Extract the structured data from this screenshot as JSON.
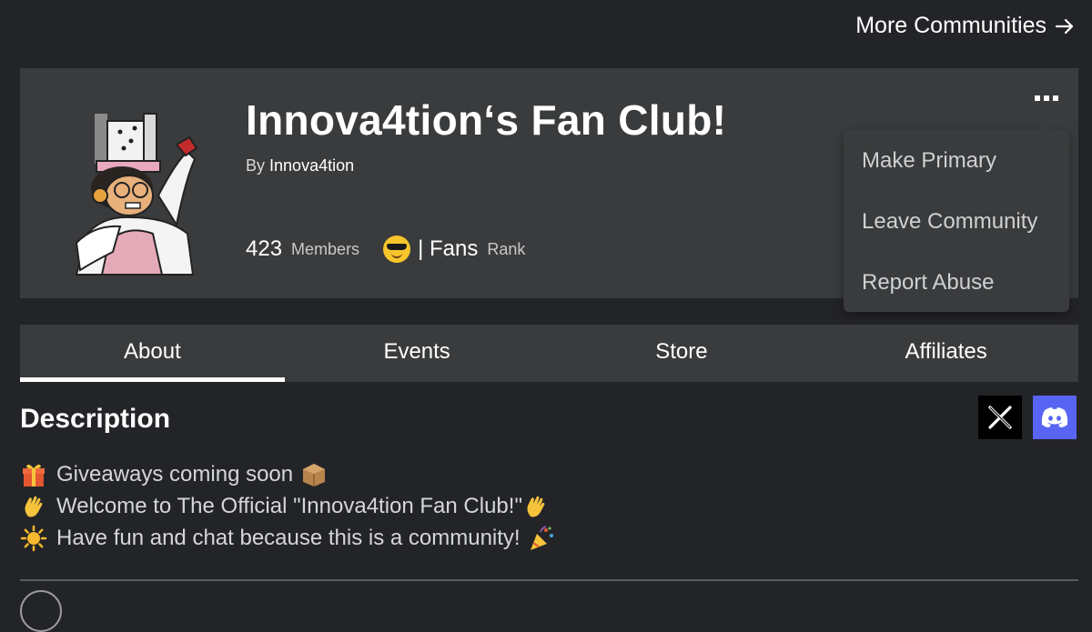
{
  "top_link": {
    "label": "More Communities"
  },
  "group": {
    "name": "Innova4tion‘s Fan Club!",
    "owner_prefix": "By",
    "owner_name": "Innova4tion",
    "members_count": "423",
    "members_label": "Members",
    "rank_name": "| Fans",
    "rank_label": "Rank"
  },
  "menu": {
    "items": [
      {
        "label": "Make Primary"
      },
      {
        "label": "Leave Community"
      },
      {
        "label": "Report Abuse"
      }
    ]
  },
  "tabs": [
    {
      "label": "About",
      "active": true
    },
    {
      "label": "Events",
      "active": false
    },
    {
      "label": "Store",
      "active": false
    },
    {
      "label": "Affiliates",
      "active": false
    }
  ],
  "description": {
    "heading": "Description",
    "lines": [
      {
        "text": "Giveaways coming soon",
        "emoji_before": "gift-emoji",
        "emoji_after": "package-emoji"
      },
      {
        "text": "Welcome to The Official \"Innova4tion Fan Club!\"",
        "emoji_before": "waving-hand-emoji",
        "emoji_after": "waving-hand-emoji"
      },
      {
        "text": "Have fun and chat because this is a community!",
        "emoji_before": "sun-emoji",
        "emoji_after": "party-popper-emoji"
      }
    ]
  },
  "social_links": [
    {
      "name": "x-icon"
    },
    {
      "name": "discord-icon"
    }
  ],
  "colors": {
    "background": "#232427",
    "card": "#393b3d",
    "discord": "#5865f2"
  }
}
